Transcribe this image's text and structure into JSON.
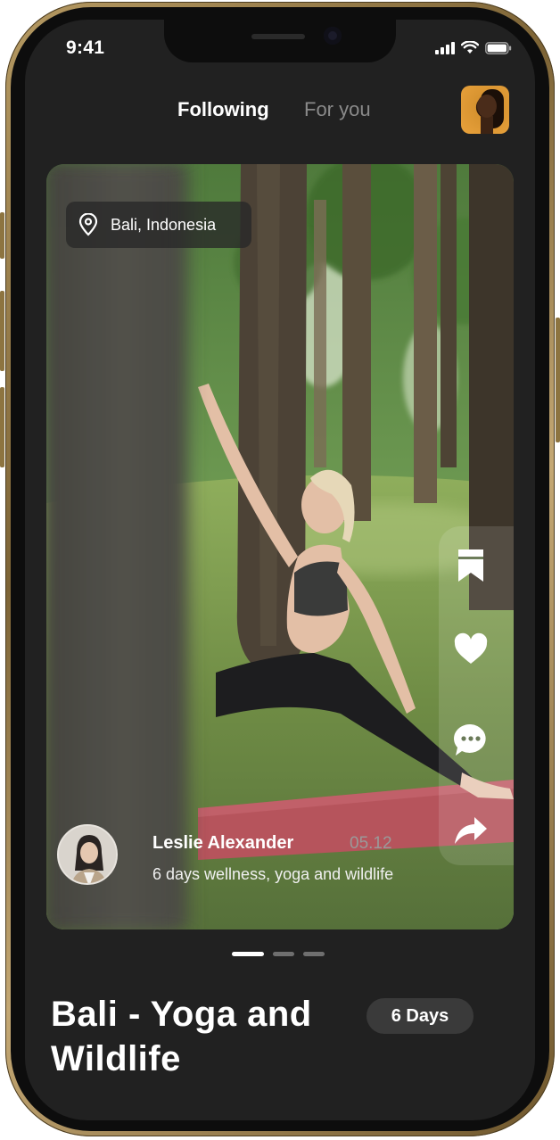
{
  "status_bar": {
    "time": "9:41"
  },
  "header": {
    "tabs": [
      {
        "label": "Following",
        "active": true
      },
      {
        "label": "For you",
        "active": false
      }
    ]
  },
  "post": {
    "location": "Bali, Indonesia",
    "author_name": "Leslie Alexander",
    "date": "05.12",
    "caption": "6 days wellness, yoga and wildlife",
    "actions": [
      "bookmark-icon",
      "heart-icon",
      "comment-icon",
      "share-icon"
    ]
  },
  "pagination": {
    "total": 3,
    "active_index": 0
  },
  "trip": {
    "title": "Bali - Yoga and Wildlife",
    "duration_badge": "6 Days"
  },
  "colors": {
    "screen_bg": "#212121",
    "frame_gold": "#b69a63",
    "mat_red": "#b6545c",
    "text_primary": "#ffffff",
    "text_muted": "#8a8a8a"
  }
}
